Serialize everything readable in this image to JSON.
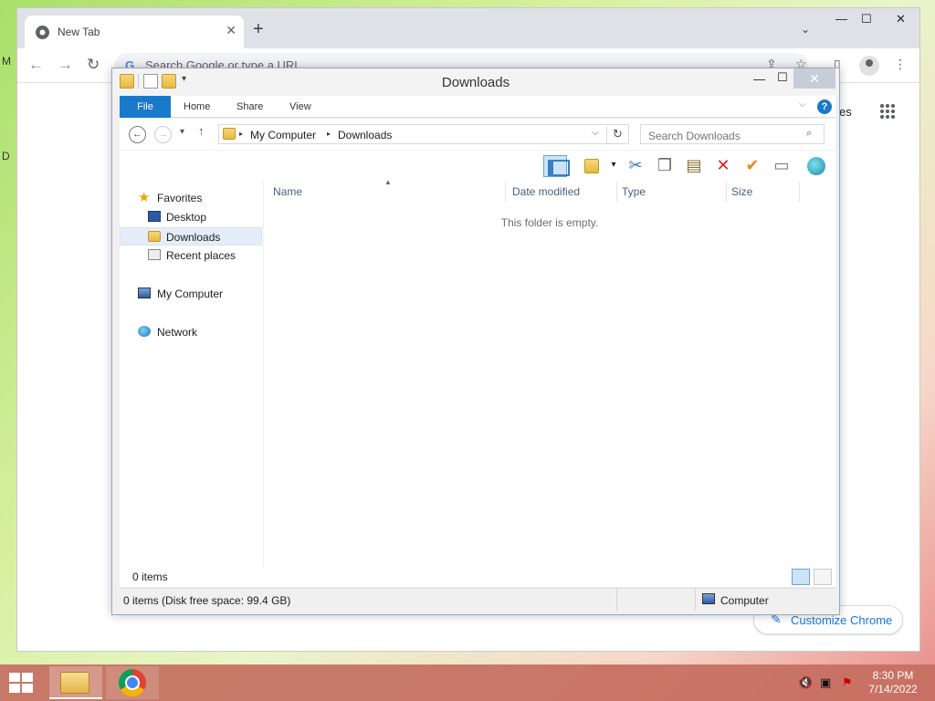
{
  "chrome": {
    "tab_title": "New Tab",
    "tab_close": "✕",
    "new_tab": "+",
    "tab_search": "⌄",
    "win_minimize": "—",
    "win_maximize": "☐",
    "win_close": "✕",
    "back": "←",
    "forward": "→",
    "reload": "↻",
    "omnibox_placeholder": "Search Google or type a URL",
    "google_mark": "G",
    "images_partial": "es",
    "customize_label": "Customize Chrome",
    "edge_letters": [
      "M",
      "D"
    ]
  },
  "explorer": {
    "title": "Downloads",
    "minimize": "—",
    "maximize": "☐",
    "close": "✕",
    "ribbon_tabs": [
      "File",
      "Home",
      "Share",
      "View"
    ],
    "help": "?",
    "back": "←",
    "forward": "→",
    "recent_dropdown": "▾",
    "up": "↑",
    "breadcrumb": [
      "My Computer",
      "Downloads"
    ],
    "breadcrumb_sep": "▸",
    "address_dropdown": "⌵",
    "refresh": "↻",
    "search_placeholder": "Search Downloads",
    "nav": {
      "favorites": "Favorites",
      "desktop": "Desktop",
      "downloads": "Downloads",
      "recent_places": "Recent places",
      "my_computer": "My Computer",
      "network": "Network"
    },
    "columns": [
      "Name",
      "Date modified",
      "Type",
      "Size"
    ],
    "empty_message": "This folder is empty.",
    "item_count": "0 items",
    "status_detail": "0 items (Disk free space: 99.4 GB)",
    "status_location": "Computer"
  },
  "taskbar": {
    "time": "8:30 PM",
    "date": "7/14/2022"
  },
  "colors": {
    "accent": "#1979ca",
    "taskbar": "#c46e60",
    "chrome_link": "#1a73e8"
  }
}
